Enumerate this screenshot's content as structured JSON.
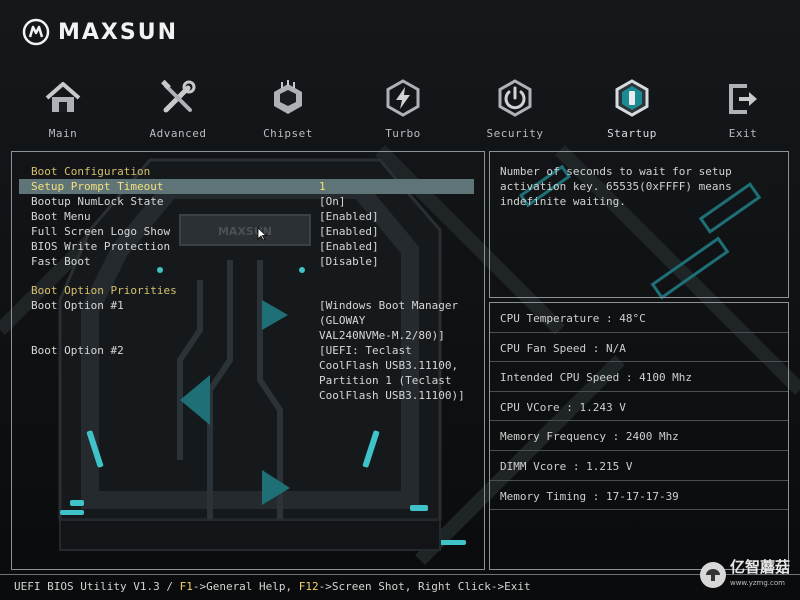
{
  "brand": {
    "name": "MAXSUN"
  },
  "nav": {
    "items": [
      {
        "label": "Main",
        "icon": "home-icon"
      },
      {
        "label": "Advanced",
        "icon": "tools-icon"
      },
      {
        "label": "Chipset",
        "icon": "chip-icon"
      },
      {
        "label": "Turbo",
        "icon": "lightning-icon"
      },
      {
        "label": "Security",
        "icon": "power-icon"
      },
      {
        "label": "Startup",
        "icon": "startup-icon"
      },
      {
        "label": "Exit",
        "icon": "exit-icon"
      }
    ],
    "active": "Startup"
  },
  "settings": {
    "boot_config_heading": "Boot Configuration",
    "rows": [
      {
        "label": "Setup Prompt Timeout",
        "value": "1"
      },
      {
        "label": "Bootup NumLock State",
        "value": "[On]"
      },
      {
        "label": "Boot Menu",
        "value": "[Enabled]"
      },
      {
        "label": "Full Screen Logo Show",
        "value": "[Enabled]"
      },
      {
        "label": "BIOS Write Protection",
        "value": "[Enabled]"
      },
      {
        "label": "Fast Boot",
        "value": "[Disable]"
      }
    ],
    "boot_priorities_heading": "Boot Option Priorities",
    "boot_options": [
      {
        "label": "Boot Option #1",
        "value": "[Windows Boot Manager\n(GLOWAY\nVAL240NVMe-M.2/80)]"
      },
      {
        "label": "Boot Option #2",
        "value": "[UEFI: Teclast\nCoolFlash USB3.11100,\nPartition 1 (Teclast\nCoolFlash USB3.11100)]"
      }
    ]
  },
  "help": {
    "text": "Number of seconds to wait for setup activation key. 65535(0xFFFF) means indefinite waiting."
  },
  "system_info": [
    "CPU Temperature : 48°C",
    "CPU Fan Speed : N/A",
    "Intended CPU Speed : 4100 Mhz",
    "CPU VCore : 1.243 V",
    "Memory Frequency : 2400 Mhz",
    "DIMM Vcore : 1.215 V",
    "Memory Timing : 17-17-17-39"
  ],
  "status_bar": {
    "prefix": "UEFI BIOS Utility V1.3 / ",
    "f1_key": "F1",
    "f1_text": "->General Help, ",
    "f12_key": "F12",
    "f12_text": "->Screen Shot, Right Click->Exit"
  },
  "watermark": {
    "text": "亿智蘑菇",
    "sub": "www.yzmg.com"
  },
  "colors": {
    "background": "#0c0d0f",
    "section_heading": "#d6c06a",
    "selection_bg": "#5e7477",
    "selection_text": "#f4e07a",
    "accent_teal": "#3fc3c8",
    "panel_border": "#8d9296"
  }
}
